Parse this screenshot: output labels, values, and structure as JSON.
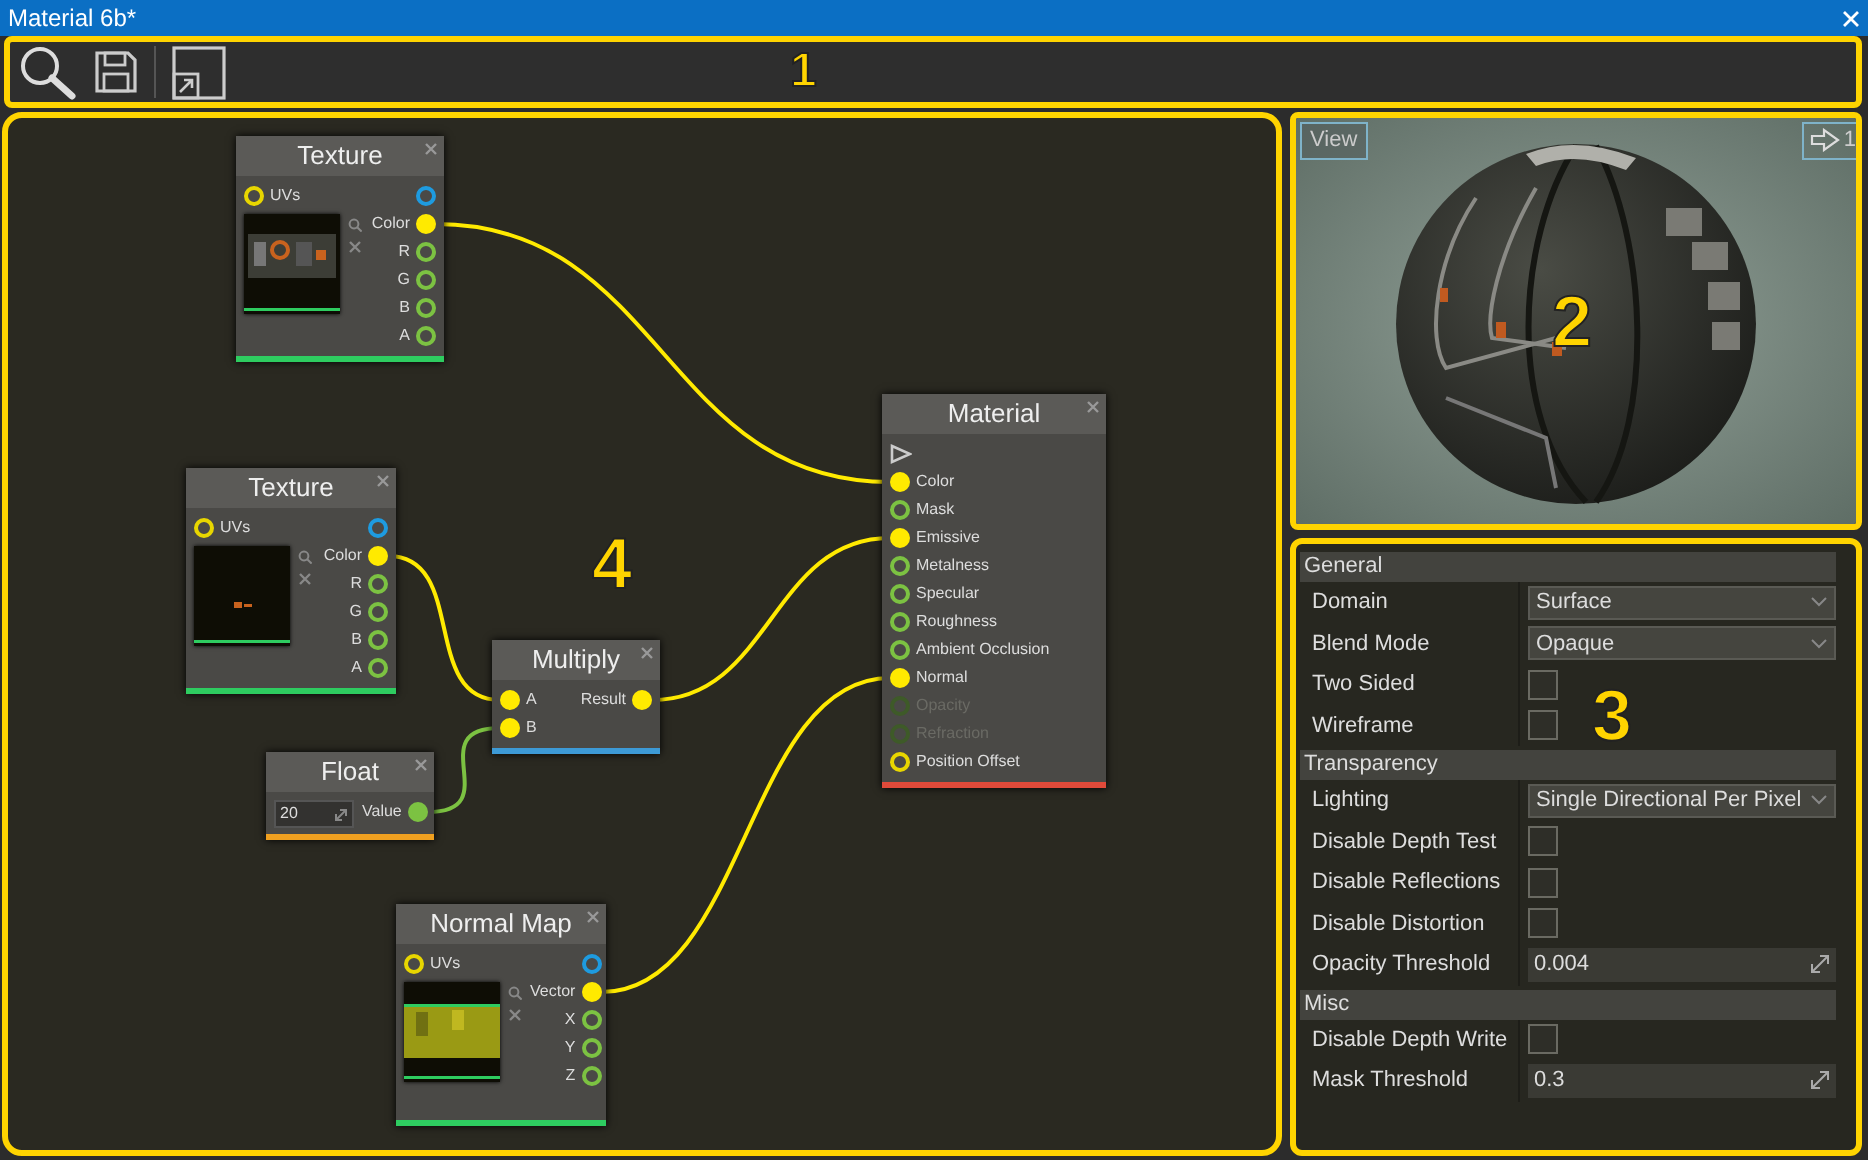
{
  "window": {
    "title": "Material 6b*"
  },
  "toolbar": {
    "callout": "1"
  },
  "graph": {
    "callout": "4",
    "nodes": [
      {
        "title": "Texture",
        "color": "#2ecc60",
        "preview": true,
        "inputs": [
          {
            "label": "UVs",
            "color": "#e8d600",
            "connected": false
          }
        ],
        "outputs": [
          {
            "color": "#1e9be0",
            "connected": false
          },
          {
            "label": "Color",
            "color": "#ffea00",
            "connected": true
          },
          {
            "label": "R",
            "color": "#7cc242",
            "connected": false
          },
          {
            "label": "G",
            "color": "#7cc242",
            "connected": false
          },
          {
            "label": "B",
            "color": "#7cc242",
            "connected": false
          },
          {
            "label": "A",
            "color": "#7cc242",
            "connected": false
          }
        ]
      },
      {
        "title": "Texture",
        "color": "#2ecc60",
        "preview": true,
        "inputs": [
          {
            "label": "UVs",
            "color": "#e8d600",
            "connected": false
          }
        ],
        "outputs": [
          {
            "color": "#1e9be0",
            "connected": false
          },
          {
            "label": "Color",
            "color": "#ffea00",
            "connected": true
          },
          {
            "label": "R",
            "color": "#7cc242",
            "connected": false
          },
          {
            "label": "G",
            "color": "#7cc242",
            "connected": false
          },
          {
            "label": "B",
            "color": "#7cc242",
            "connected": false
          },
          {
            "label": "A",
            "color": "#7cc242",
            "connected": false
          }
        ]
      },
      {
        "title": "Multiply",
        "color": "#3d9ad6",
        "inputs": [
          {
            "label": "A",
            "color": "#ffea00",
            "connected": true
          },
          {
            "label": "B",
            "color": "#ffea00",
            "connected": true
          }
        ],
        "outputs": [
          {
            "label": "Result",
            "color": "#ffea00",
            "connected": true
          }
        ]
      },
      {
        "title": "Float",
        "color": "#f0a020",
        "value": "20",
        "outputs": [
          {
            "label": "Value",
            "color": "#7cc242",
            "connected": true
          }
        ]
      },
      {
        "title": "Normal Map",
        "color": "#2ecc60",
        "preview": true,
        "inputs": [
          {
            "label": "UVs",
            "color": "#e8d600",
            "connected": false
          }
        ],
        "outputs": [
          {
            "color": "#1e9be0",
            "connected": false
          },
          {
            "label": "Vector",
            "color": "#ffea00",
            "connected": true
          },
          {
            "label": "X",
            "color": "#7cc242",
            "connected": false
          },
          {
            "label": "Y",
            "color": "#7cc242",
            "connected": false
          },
          {
            "label": "Z",
            "color": "#7cc242",
            "connected": false
          }
        ]
      },
      {
        "title": "Material",
        "color": "#e04a3a",
        "inputs": [
          {
            "kind": "arrow",
            "color": "#cccccc"
          },
          {
            "kind": "socket",
            "label": "Color",
            "color": "#ffea00",
            "connected": true,
            "disabled": false
          },
          {
            "kind": "socket",
            "label": "Mask",
            "color": "#7cc242",
            "connected": false,
            "disabled": false
          },
          {
            "kind": "socket",
            "label": "Emissive",
            "color": "#ffea00",
            "connected": true,
            "disabled": false
          },
          {
            "kind": "socket",
            "label": "Metalness",
            "color": "#7cc242",
            "connected": false,
            "disabled": false
          },
          {
            "kind": "socket",
            "label": "Specular",
            "color": "#7cc242",
            "connected": false,
            "disabled": false
          },
          {
            "kind": "socket",
            "label": "Roughness",
            "color": "#7cc242",
            "connected": false,
            "disabled": false
          },
          {
            "kind": "socket",
            "label": "Ambient Occlusion",
            "color": "#7cc242",
            "connected": false,
            "disabled": false
          },
          {
            "kind": "socket",
            "label": "Normal",
            "color": "#ffea00",
            "connected": true,
            "disabled": false
          },
          {
            "kind": "socket",
            "label": "Opacity",
            "color": "#3e5a28",
            "connected": false,
            "disabled": true
          },
          {
            "kind": "socket",
            "label": "Refraction",
            "color": "#3e5a28",
            "connected": false,
            "disabled": true
          },
          {
            "kind": "socket",
            "label": "Position Offset",
            "color": "#e8d600",
            "connected": false,
            "disabled": false
          }
        ]
      }
    ]
  },
  "viewport": {
    "callout": "2",
    "view_button": "View",
    "camera_label": "1"
  },
  "properties": {
    "callout": "3",
    "sections": [
      {
        "title": "General",
        "rows": [
          {
            "label": "Domain",
            "kind": "dropdown",
            "value": "Surface"
          },
          {
            "label": "Blend Mode",
            "kind": "dropdown",
            "value": "Opaque"
          },
          {
            "label": "Two Sided",
            "kind": "checkbox",
            "checked": false
          },
          {
            "label": "Wireframe",
            "kind": "checkbox",
            "checked": false
          }
        ]
      },
      {
        "title": "Transparency",
        "rows": [
          {
            "label": "Lighting",
            "kind": "dropdown",
            "value": "Single Directional Per Pixel"
          },
          {
            "label": "Disable Depth Test",
            "kind": "checkbox",
            "checked": false
          },
          {
            "label": "Disable Reflections",
            "kind": "checkbox",
            "checked": false
          },
          {
            "label": "Disable Distortion",
            "kind": "checkbox",
            "checked": false
          },
          {
            "label": "Opacity Threshold",
            "kind": "number",
            "value": "0.004"
          }
        ]
      },
      {
        "title": "Misc",
        "rows": [
          {
            "label": "Disable Depth Write",
            "kind": "checkbox",
            "checked": false
          },
          {
            "label": "Mask Threshold",
            "kind": "number",
            "value": "0.3"
          }
        ]
      }
    ]
  }
}
